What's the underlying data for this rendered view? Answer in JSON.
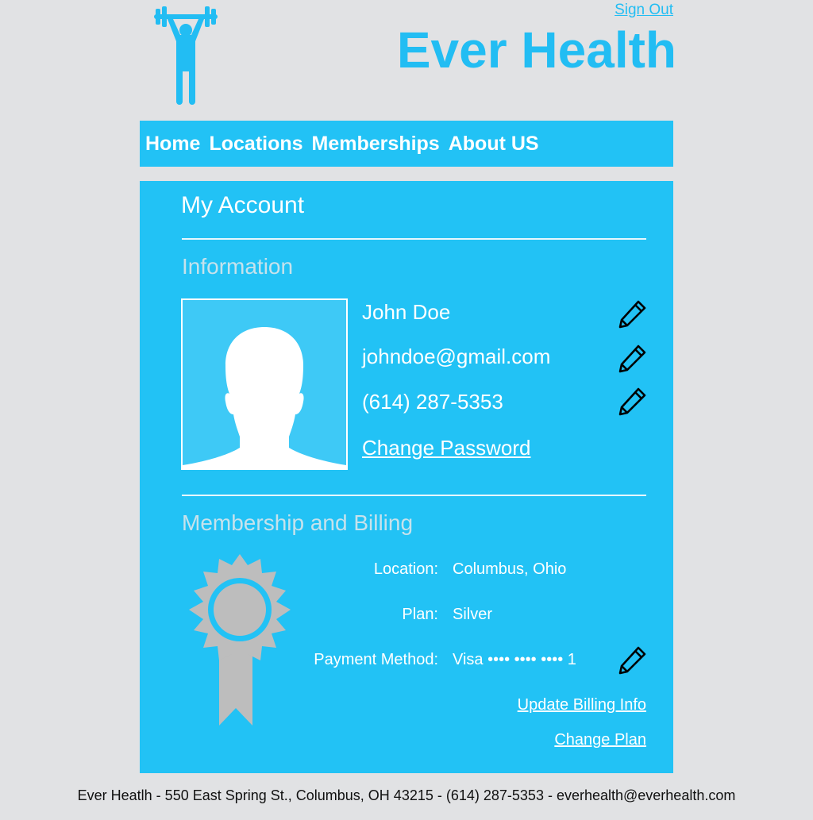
{
  "header": {
    "brand": "Ever Health",
    "sign_out": "Sign Out",
    "logo_icon": "weightlifter-icon"
  },
  "nav": {
    "items": [
      {
        "label": "Home"
      },
      {
        "label": "Locations"
      },
      {
        "label": "Memberships"
      },
      {
        "label": "About US"
      }
    ]
  },
  "account": {
    "title": "My Account",
    "information": {
      "heading": "Information",
      "avatar_icon": "user-silhouette-icon",
      "name": "John Doe",
      "email": "johndoe@gmail.com",
      "phone": "(614) 287-5353",
      "change_password": "Change Password"
    },
    "billing": {
      "heading": "Membership and Billing",
      "badge_icon": "award-ribbon-icon",
      "location_label": "Location:",
      "location_value": "Columbus, Ohio",
      "plan_label": "Plan:",
      "plan_value": "Silver",
      "payment_label": "Payment Method:",
      "payment_value": "Visa •••• •••• •••• 1",
      "update_billing": "Update Billing Info",
      "change_plan": "Change Plan"
    }
  },
  "footer": {
    "text": "Ever Heatlh - 550 East Spring St., Columbus, OH 43215 - (614) 287-5353 - everhealth@everhealth.com"
  },
  "colors": {
    "accent": "#22c2f5",
    "background": "#e1e2e4",
    "section_heading": "#c6e2ec",
    "badge_gray": "#bdbdbd"
  }
}
